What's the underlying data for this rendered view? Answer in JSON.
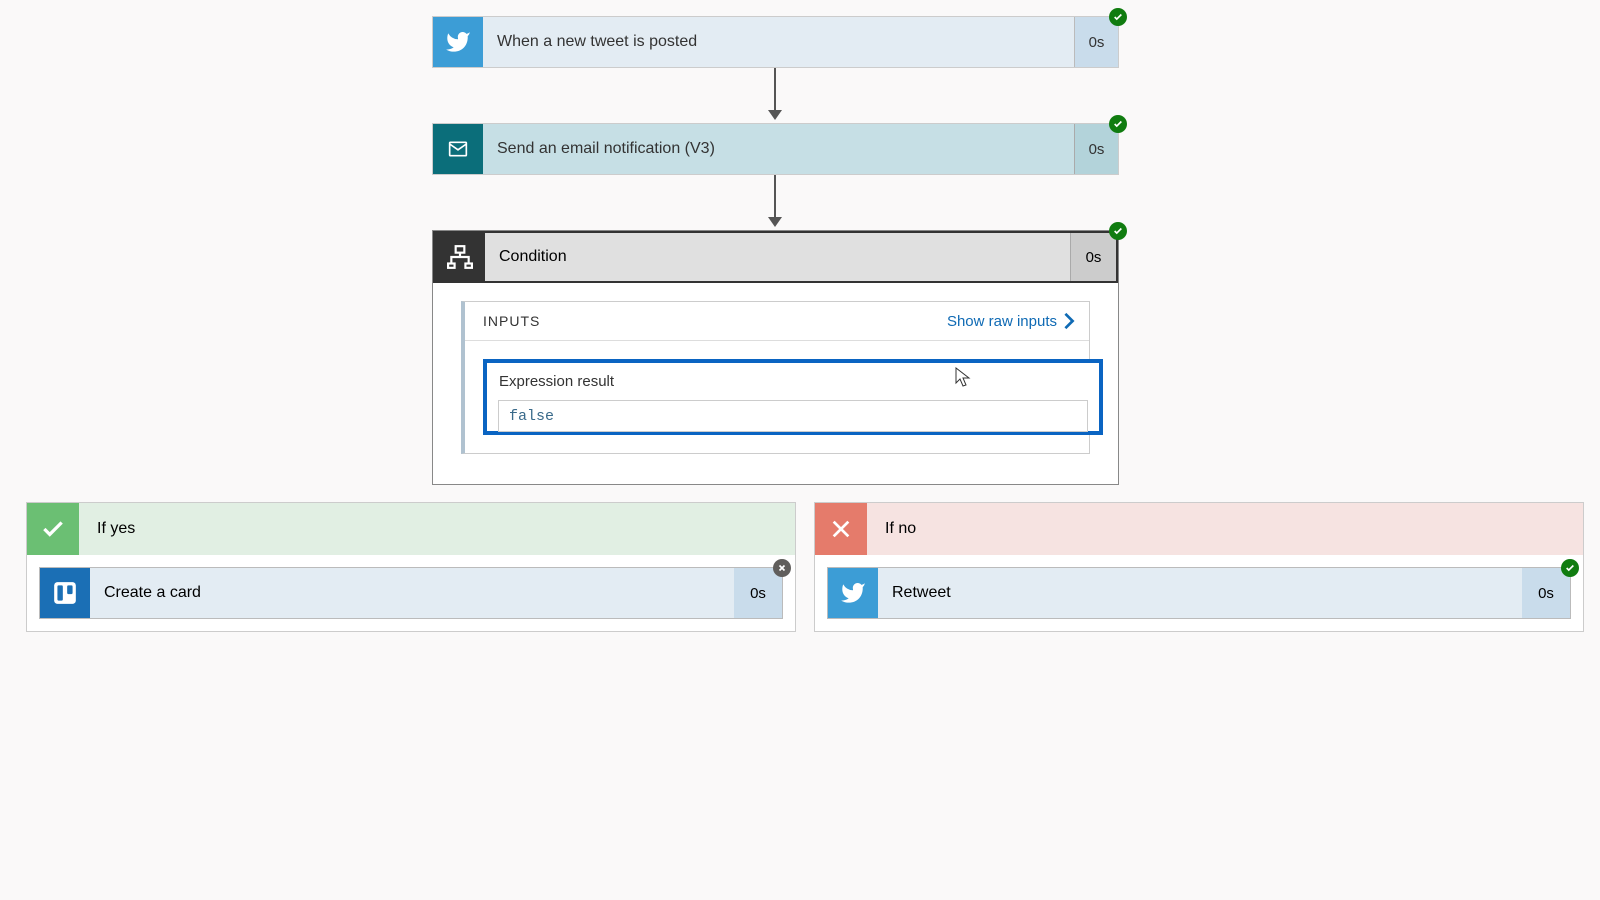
{
  "steps": {
    "trigger": {
      "label": "When a new tweet is posted",
      "duration": "0s",
      "status": "success"
    },
    "email": {
      "label": "Send an email notification (V3)",
      "duration": "0s",
      "status": "success"
    },
    "condition": {
      "label": "Condition",
      "duration": "0s",
      "status": "success"
    }
  },
  "condition_panel": {
    "inputs_title": "INPUTS",
    "show_raw_label": "Show raw inputs",
    "expression_label": "Expression result",
    "expression_value": "false"
  },
  "branches": {
    "yes": {
      "label": "If yes",
      "action": {
        "label": "Create a card",
        "duration": "0s",
        "status": "skipped"
      }
    },
    "no": {
      "label": "If no",
      "action": {
        "label": "Retweet",
        "duration": "0s",
        "status": "success"
      }
    }
  }
}
